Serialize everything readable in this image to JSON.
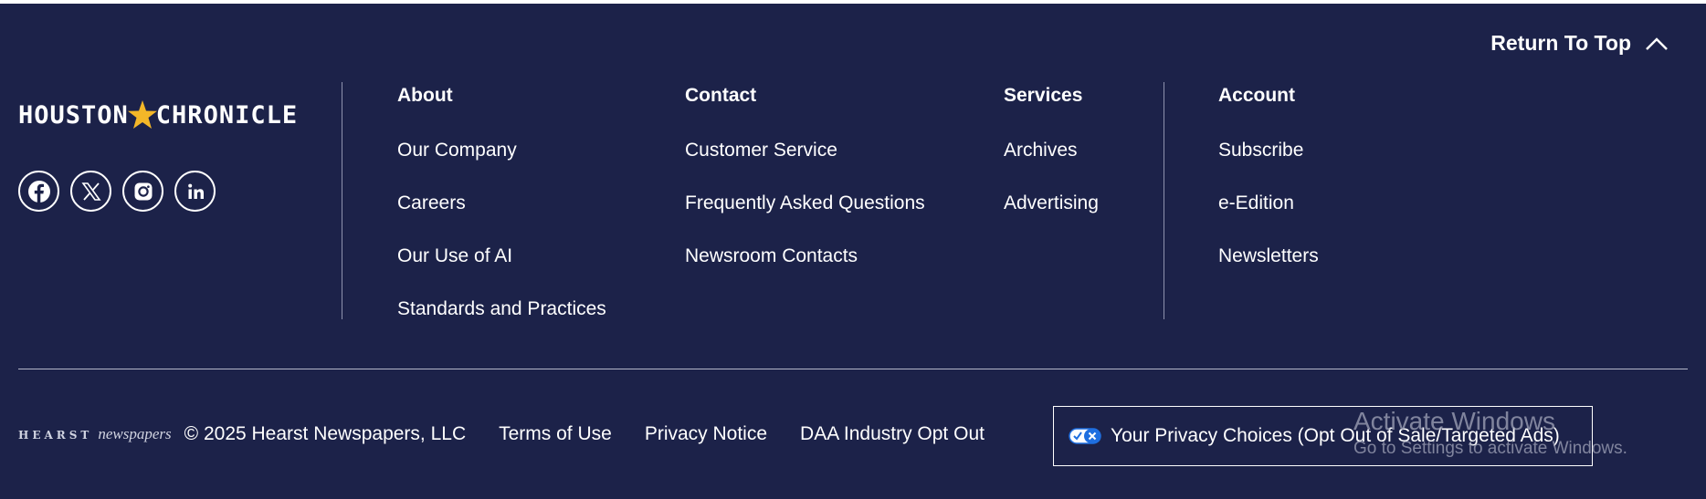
{
  "return_top": {
    "label": "Return To Top",
    "icon": "chevron-up-icon"
  },
  "brand": {
    "left": "HOUSTON",
    "right": "CHRONICLE",
    "star_color": "#f4b728"
  },
  "social": [
    {
      "name": "facebook-icon"
    },
    {
      "name": "x-icon"
    },
    {
      "name": "instagram-icon"
    },
    {
      "name": "linkedin-icon"
    }
  ],
  "columns": {
    "about": {
      "heading": "About",
      "links": [
        "Our Company",
        "Careers",
        "Our Use of AI",
        "Standards and Practices"
      ]
    },
    "contact": {
      "heading": "Contact",
      "links": [
        "Customer Service",
        "Frequently Asked Questions",
        "Newsroom Contacts"
      ]
    },
    "services": {
      "heading": "Services",
      "links": [
        "Archives",
        "Advertising"
      ]
    },
    "account": {
      "heading": "Account",
      "links": [
        "Subscribe",
        "e-Edition",
        "Newsletters"
      ]
    }
  },
  "bottom": {
    "hearst_word": "HEARST",
    "hearst_sub": "newspapers",
    "copyright": "© 2025 Hearst Newspapers, LLC",
    "terms": "Terms of Use",
    "privacy_notice": "Privacy Notice",
    "daa": "DAA Industry Opt Out",
    "privacy_choices": "Your Privacy Choices (Opt Out of Sale/Targeted Ads)"
  },
  "watermark": {
    "line1": "Activate Windows",
    "line2": "Go to Settings to activate Windows."
  },
  "colors": {
    "background": "#1c2249",
    "text": "#ffffff",
    "privacy_toggle": "#1f6fe0"
  }
}
